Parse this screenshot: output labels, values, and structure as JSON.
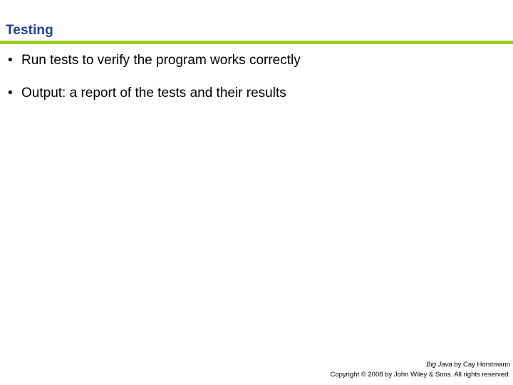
{
  "slide": {
    "title": "Testing",
    "title_color": "#21409A",
    "rule_color": "#9ACA1E",
    "background_color": "#FFFFFF",
    "body_text_color": "#000000",
    "bullets": [
      {
        "marker": "•",
        "text": "Run tests to verify the program works correctly"
      },
      {
        "marker": "•",
        "text": "Output: a report of the tests and their results"
      }
    ],
    "footer": {
      "line1_book": "Big Java",
      "line1_rest": " by Cay Horstmann",
      "line2": "Copyright © 2008 by John Wiley & Sons.  All rights reserved."
    }
  }
}
